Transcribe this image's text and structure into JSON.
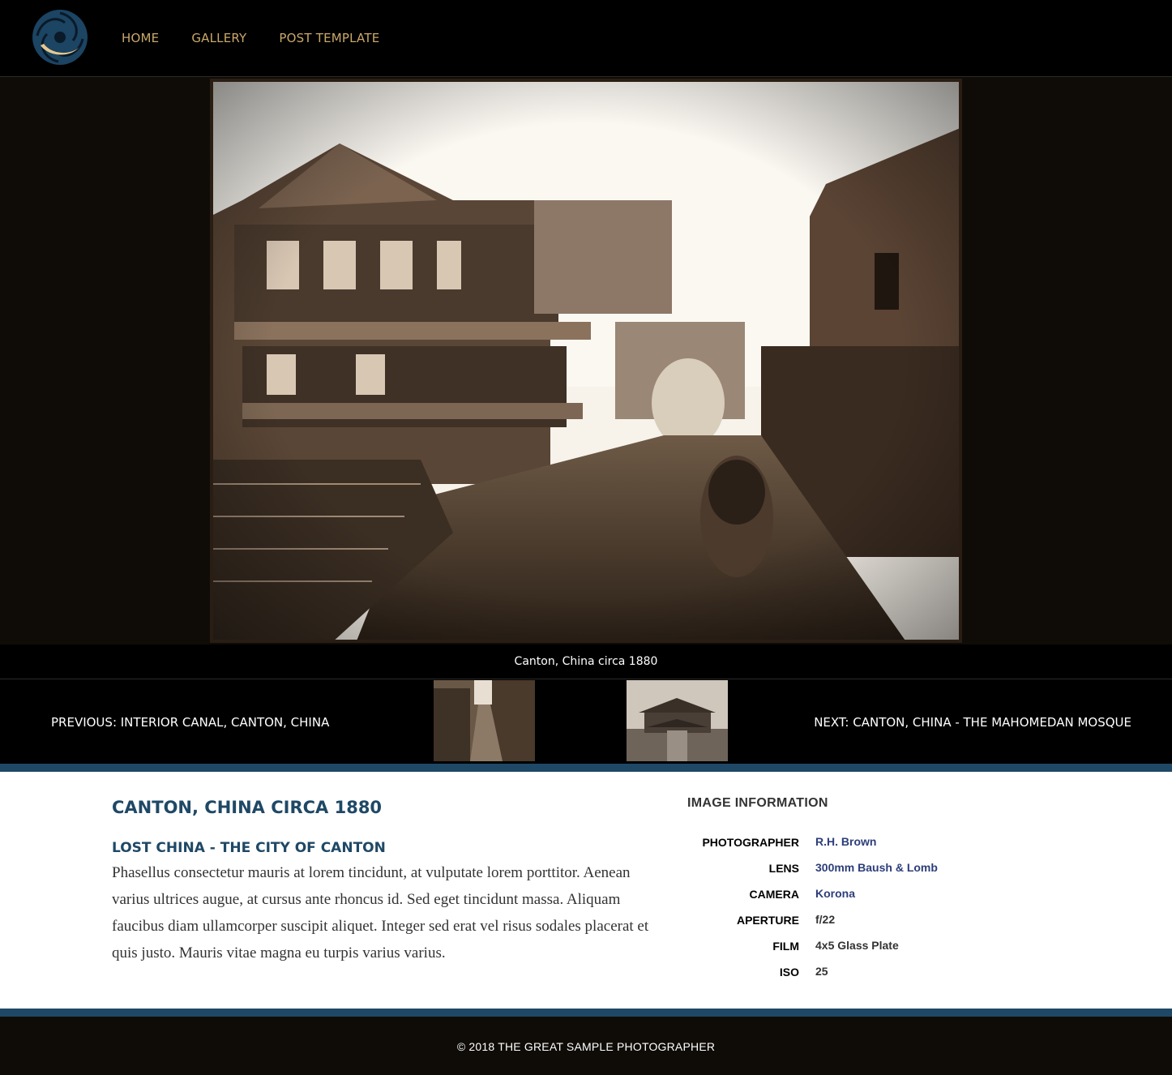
{
  "nav": {
    "items": [
      "HOME",
      "GALLERY",
      "POST TEMPLATE"
    ]
  },
  "photo": {
    "caption": "Canton, China circa 1880"
  },
  "pager": {
    "previous_label": "PREVIOUS: INTERIOR CANAL, CANTON, CHINA",
    "next_label": "NEXT: CANTON, CHINA - THE MAHOMEDAN MOSQUE"
  },
  "post": {
    "title": "CANTON, CHINA CIRCA 1880",
    "subtitle": "LOST CHINA - THE CITY OF CANTON",
    "body": "Phasellus consectetur mauris at lorem tincidunt, at vulputate lorem porttitor. Aenean varius ultrices augue, at cursus ante rhoncus id. Sed eget tincidunt massa. Aliquam faucibus diam ullamcorper suscipit aliquet. Integer sed erat vel risus sodales placerat et quis justo. Mauris vitae magna eu turpis varius varius."
  },
  "image_info": {
    "title": "IMAGE INFORMATION",
    "rows": [
      {
        "label": "PHOTOGRAPHER",
        "value": "R.H. Brown"
      },
      {
        "label": "LENS",
        "value": "300mm Baush & Lomb"
      },
      {
        "label": "CAMERA",
        "value": "Korona"
      },
      {
        "label": "APERTURE",
        "value": "f/22"
      },
      {
        "label": "FILM",
        "value": "4x5 Glass Plate"
      },
      {
        "label": "ISO",
        "value": "25"
      }
    ]
  },
  "footer": {
    "copyright": "© 2018 THE GREAT SAMPLE PHOTOGRAPHER"
  },
  "colors": {
    "accent_gold": "#c9a86a",
    "brand_blue": "#1f4866",
    "link_blue": "#2c3e7a",
    "dark_bg": "#0f0c07"
  },
  "icons": {
    "logo": "swirl-logo-icon"
  }
}
